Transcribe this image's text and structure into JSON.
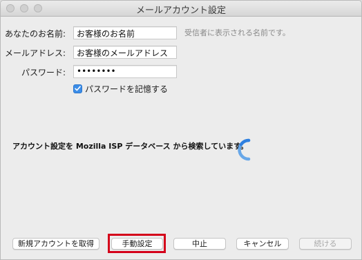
{
  "window": {
    "title": "メールアカウント設定"
  },
  "form": {
    "name_label": "あなたのお名前:",
    "name_value": "お客様のお名前",
    "name_hint": "受信者に表示される名前です。",
    "email_label": "メールアドレス:",
    "email_value": "お客様のメールアドレス",
    "password_label": "パスワード:",
    "password_value": "••••••••",
    "remember_label": "パスワードを記憶する",
    "remember_checked": true
  },
  "status": {
    "message": "アカウント設定を Mozilla ISP データベース から検索しています。"
  },
  "buttons": {
    "new_account": "新規アカウントを取得",
    "manual_config": "手動設定",
    "stop": "中止",
    "cancel": "キャンセル",
    "continue": "続ける"
  },
  "colors": {
    "accent": "#3b8de8",
    "highlight": "#d4001a"
  }
}
